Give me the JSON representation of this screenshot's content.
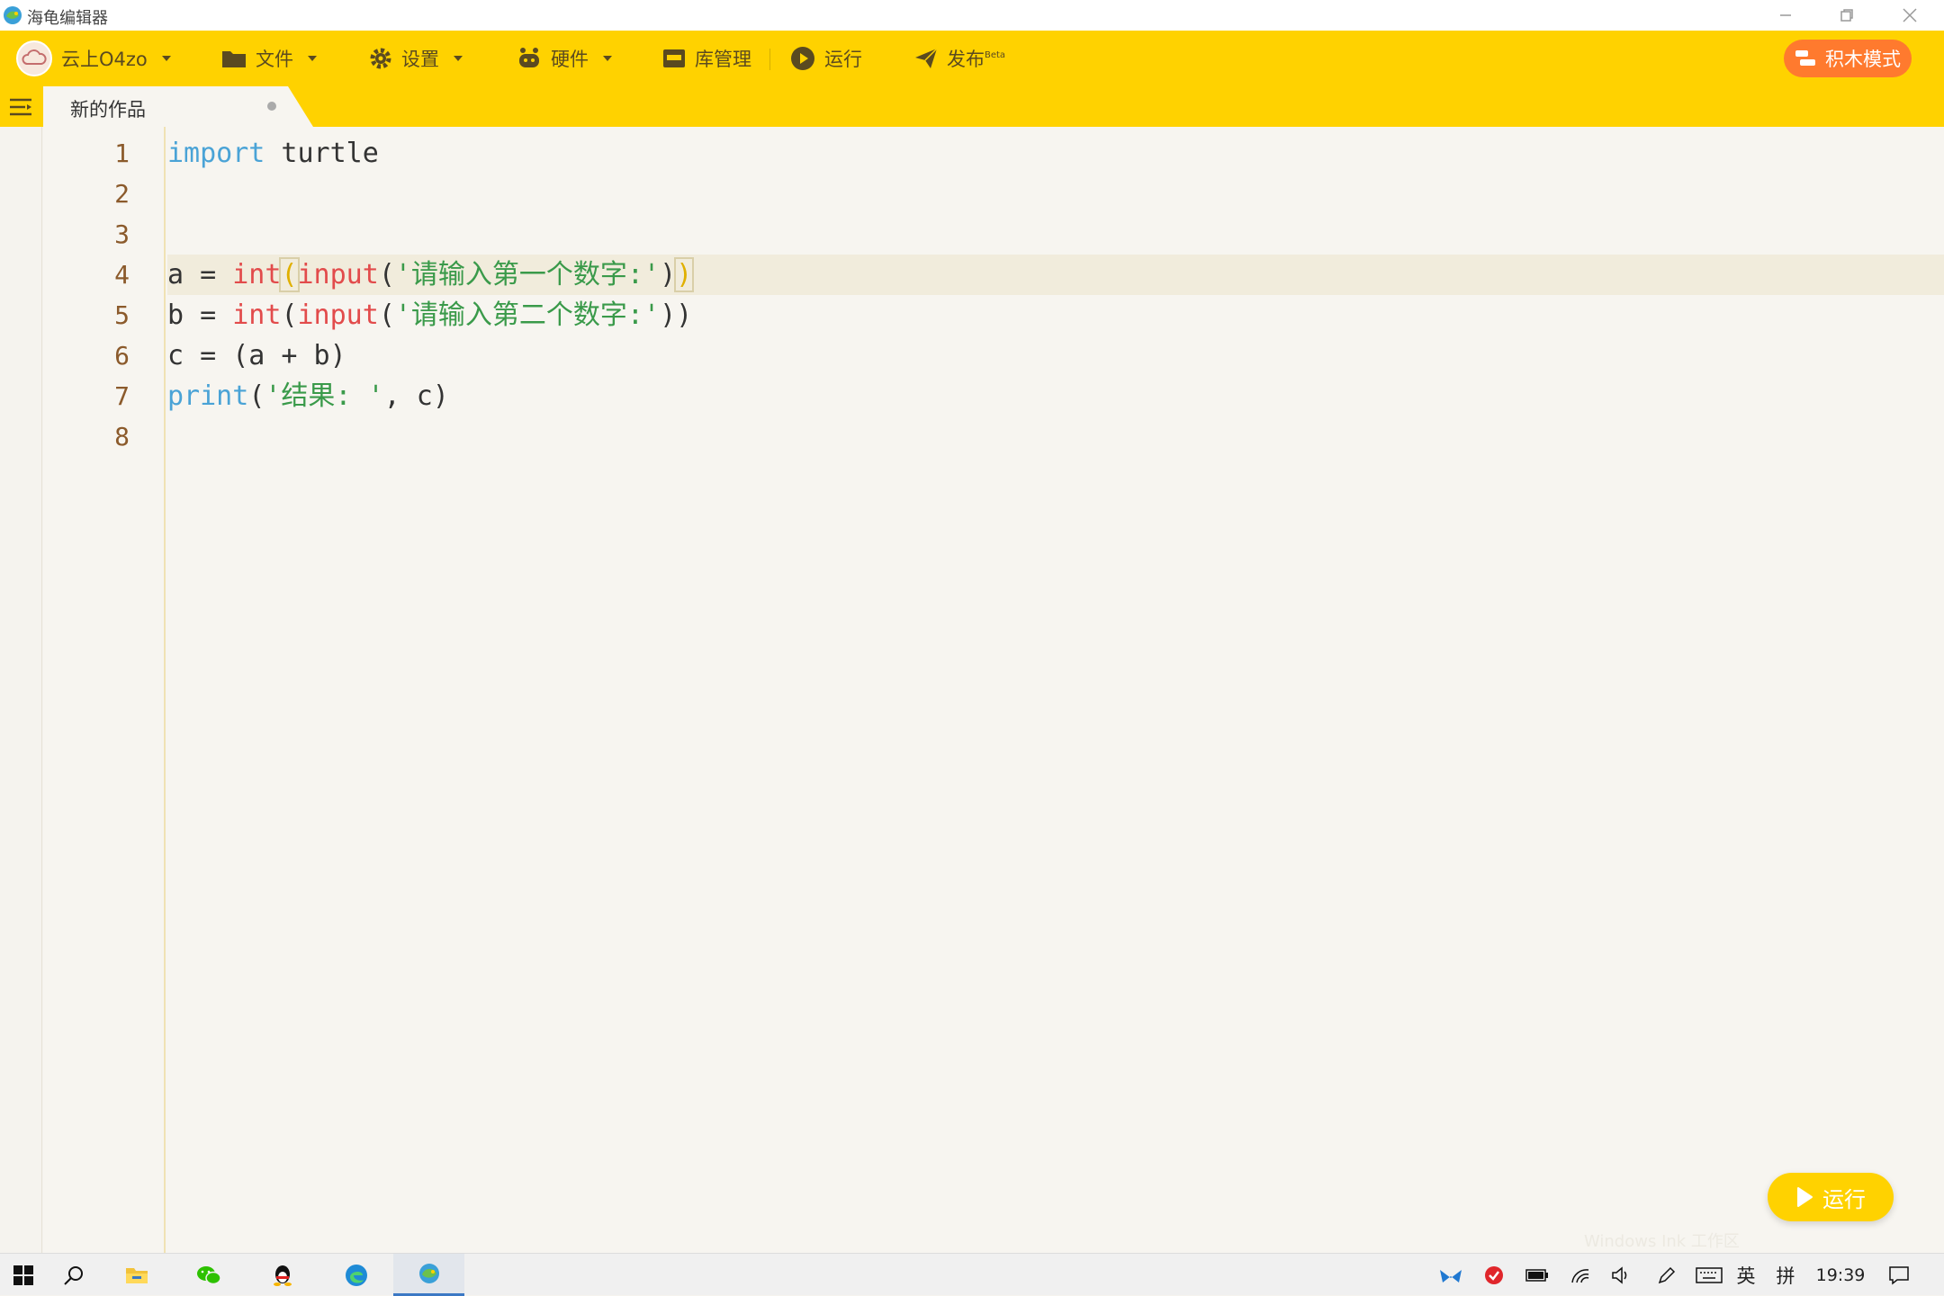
{
  "window": {
    "title": "海龟编辑器",
    "controls": [
      "minimize-icon",
      "restore-icon",
      "close-icon"
    ]
  },
  "toolbar": {
    "user_label": "云上O4zo",
    "file_label": "文件",
    "settings_label": "设置",
    "hardware_label": "硬件",
    "library_label": "库管理",
    "run_label": "运行",
    "publish_label": "发布",
    "publish_badge": "Beta",
    "block_mode_label": "积木模式"
  },
  "tabs": [
    {
      "label": "新的作品",
      "modified": true
    }
  ],
  "editor": {
    "active_line": 4,
    "line_numbers": [
      "1",
      "2",
      "3",
      "4",
      "5",
      "6",
      "7",
      "8"
    ],
    "lines": [
      {
        "tokens": [
          {
            "t": "import",
            "c": "kw"
          },
          {
            "t": " turtle",
            "c": "plain"
          }
        ]
      },
      {
        "tokens": []
      },
      {
        "tokens": []
      },
      {
        "tokens": [
          {
            "t": "a = ",
            "c": "plain"
          },
          {
            "t": "int",
            "c": "fn"
          },
          {
            "t": "(",
            "c": "br-hl"
          },
          {
            "t": "input",
            "c": "fn"
          },
          {
            "t": "(",
            "c": "plain"
          },
          {
            "t": "'请输入第一个数字:'",
            "c": "str"
          },
          {
            "t": ")",
            "c": "plain"
          },
          {
            "t": ")",
            "c": "br-hl"
          }
        ]
      },
      {
        "tokens": [
          {
            "t": "b = ",
            "c": "plain"
          },
          {
            "t": "int",
            "c": "fn"
          },
          {
            "t": "(",
            "c": "plain"
          },
          {
            "t": "input",
            "c": "fn"
          },
          {
            "t": "(",
            "c": "plain"
          },
          {
            "t": "'请输入第二个数字:'",
            "c": "str"
          },
          {
            "t": "))",
            "c": "plain"
          }
        ]
      },
      {
        "tokens": [
          {
            "t": "c = (a + b)",
            "c": "plain"
          }
        ]
      },
      {
        "tokens": [
          {
            "t": "print",
            "c": "kw"
          },
          {
            "t": "(",
            "c": "plain"
          },
          {
            "t": "'结果: '",
            "c": "str"
          },
          {
            "t": ", c)",
            "c": "plain"
          }
        ]
      },
      {
        "tokens": []
      }
    ]
  },
  "run_button_label": "运行",
  "watermark": "Windows Ink 工作区",
  "taskbar": {
    "apps": [
      "windows-start-icon",
      "search-icon",
      "file-explorer-icon",
      "wechat-icon",
      "qq-icon",
      "edge-icon",
      "turtle-editor-icon"
    ],
    "tray": {
      "input_lang": "英",
      "input_mode": "拼",
      "time": "19:39"
    }
  },
  "colors": {
    "accent": "#ffd200",
    "block_mode": "#ff7a2e",
    "keyword": "#4aa3d6",
    "function": "#e24b4b",
    "string": "#3a9a4a",
    "line_number": "#8b5a2b"
  }
}
